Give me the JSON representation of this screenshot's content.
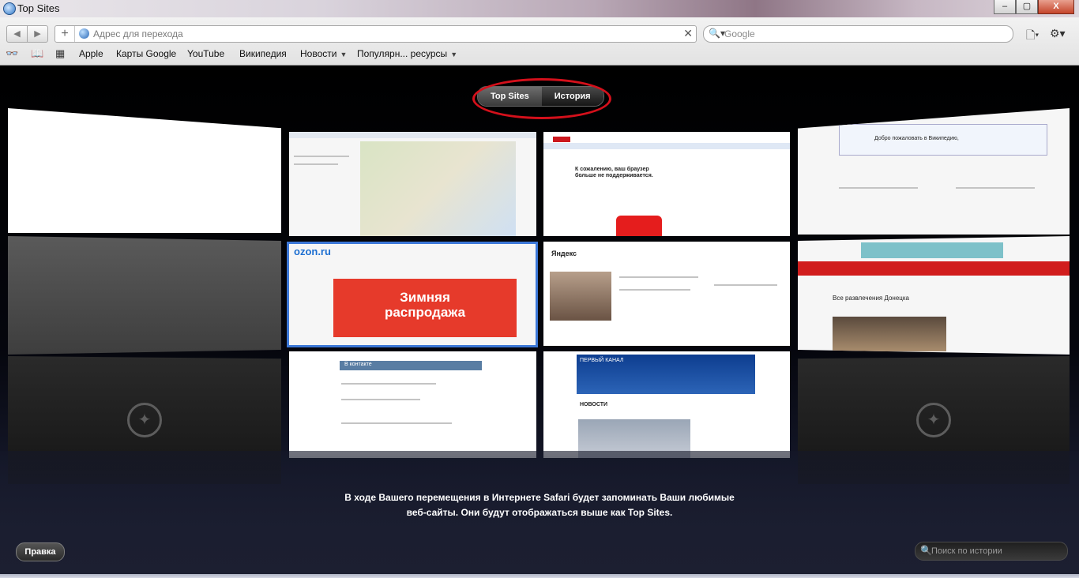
{
  "window": {
    "title": "Top Sites",
    "minimize_label": "–",
    "maximize_label": "▢",
    "close_label": "X"
  },
  "toolbar": {
    "back_label": "◀",
    "forward_label": "▶",
    "add_label": "+",
    "address_placeholder": "Адрес для перехода",
    "clear_label": "✕",
    "search_placeholder": "Google",
    "search_icon_label": "🔍▾",
    "page_menu_label": "🗋▾",
    "settings_menu_label": "⚙▾"
  },
  "bookmarks": {
    "reading_list_icon_label": "👓",
    "book_icon_label": "📖",
    "grid_icon_label": "▦",
    "items": [
      {
        "label": "Apple"
      },
      {
        "label": "Карты Google"
      },
      {
        "label": "YouTube"
      },
      {
        "label": "Википедия"
      },
      {
        "label": "Новости",
        "dropdown": true
      },
      {
        "label": "Популярн... ресурсы",
        "dropdown": true
      }
    ],
    "dropdown_arrow": "▼"
  },
  "top_sites": {
    "tabs": [
      {
        "label": "Top Sites",
        "active": true
      },
      {
        "label": "История",
        "active": false
      }
    ],
    "annotation_color": "#d4101b",
    "tiles": {
      "ozon_logo": "ozon.ru",
      "ozon_promo_line1": "Зимняя",
      "ozon_promo_line2": "распродажа",
      "news_header": "ПЕРВЫЙ КАНАЛ",
      "news_section": "НОВОСТИ",
      "youtube_text_line1": "К сожалению, ваш браузер",
      "youtube_text_line2": "больше не поддерживается.",
      "donetsk_title": "Все развлечения Донецка",
      "yandex_logo": "Яндекс",
      "vk_logo": "В контакте",
      "wiki_text": "Добро пожаловать в Википедию,",
      "compass_glyph": "✦"
    }
  },
  "message": {
    "line1": "В ходе Вашего перемещения в Интернете Safari будет запоминать Ваши любимые",
    "line2": "веб-сайты. Они будут отображаться выше как Top Sites."
  },
  "footer": {
    "edit_label": "Правка",
    "history_search_placeholder": "Поиск по истории",
    "history_search_icon": "🔍"
  }
}
